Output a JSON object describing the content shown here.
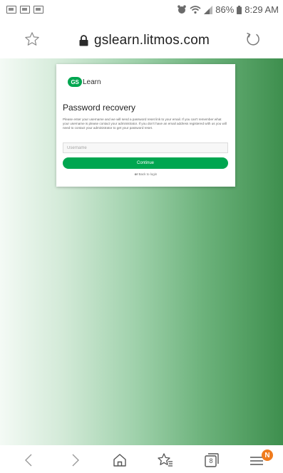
{
  "status_bar": {
    "battery": "86%",
    "time": "8:29 AM"
  },
  "address_bar": {
    "url": "gslearn.litmos.com"
  },
  "card": {
    "logo_badge": "GS",
    "logo_text": "Learn",
    "title": "Password recovery",
    "description": "Please enter your username and we will send a password reset link to your email. If you can't remember what your username is please contact your administrator. If you don't have an email address registered with us you will need to contact your administrator to get your password reset.",
    "username_placeholder": "Username",
    "continue_label": "Continue",
    "or_label": "or",
    "back_link": "Back to login"
  },
  "bottom_nav": {
    "tab_count": "8",
    "notification_badge": "N"
  },
  "colors": {
    "brand_green": "#00a650",
    "badge_orange": "#f07c1e"
  }
}
